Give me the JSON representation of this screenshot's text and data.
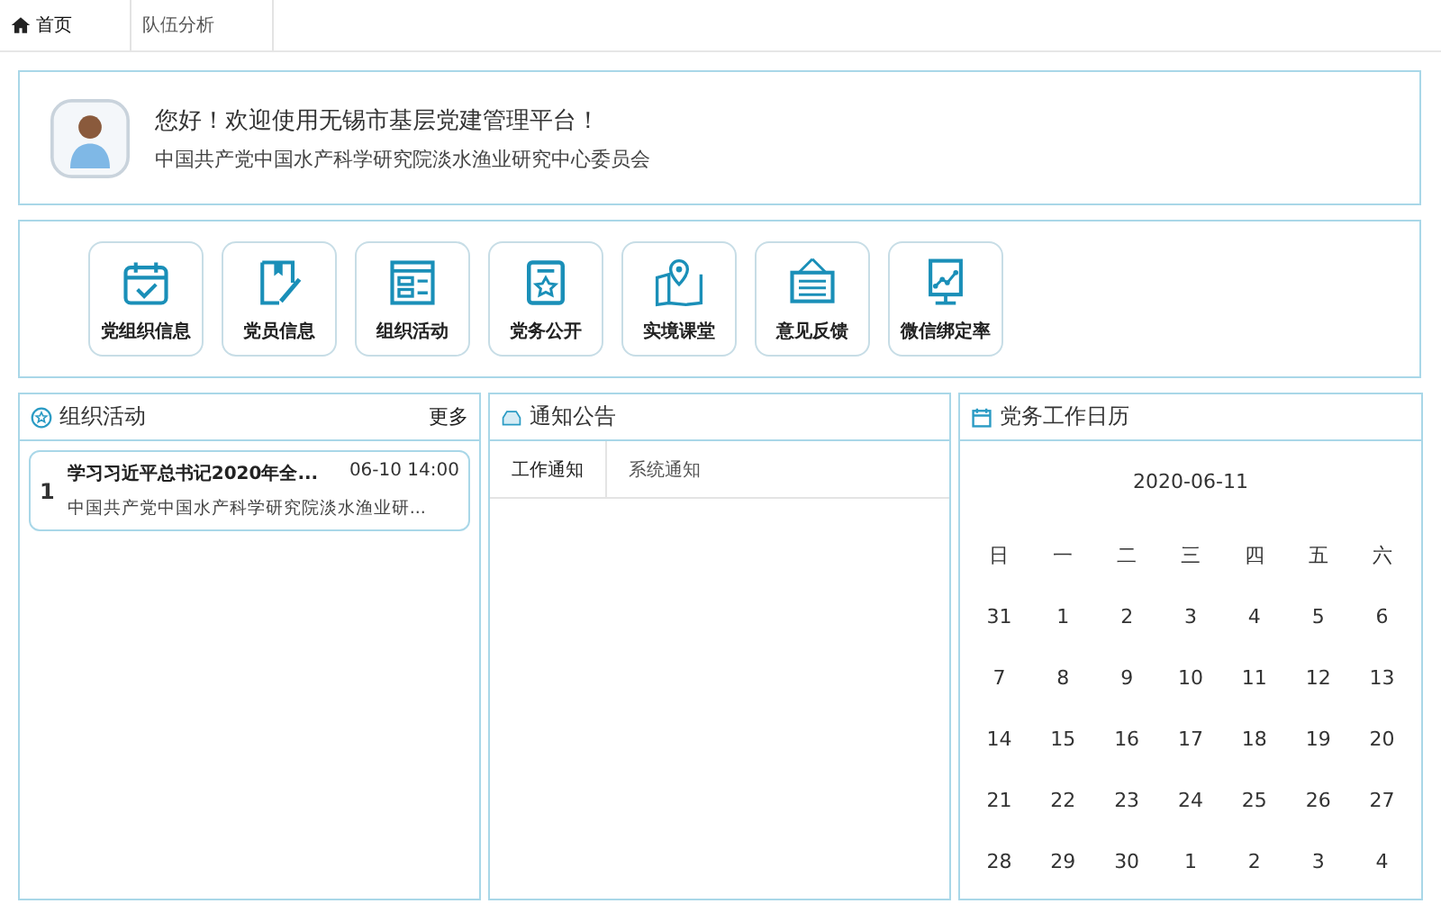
{
  "tabs": [
    {
      "label": "首页",
      "selected": true
    },
    {
      "label": "队伍分析",
      "selected": false
    }
  ],
  "welcome": {
    "greeting": "您好！欢迎使用无锡市基层党建管理平台！",
    "organization": "中国共产党中国水产科学研究院淡水渔业研究中心委员会"
  },
  "shortcuts": [
    "党组织信息",
    "党员信息",
    "组织活动",
    "党务公开",
    "实境课堂",
    "意见反馈",
    "微信绑定率"
  ],
  "activities": {
    "title": "组织活动",
    "more": "更多",
    "items": [
      {
        "number": "1",
        "title": "学习习近平总书记2020年全...",
        "time": "06-10 14:00",
        "organization": "中国共产党中国水产科学研究院淡水渔业研..."
      }
    ]
  },
  "notices": {
    "title": "通知公告",
    "tabs": [
      {
        "label": "工作通知",
        "selected": true
      },
      {
        "label": "系统通知",
        "selected": false
      }
    ]
  },
  "calendar": {
    "title": "党务工作日历",
    "date": "2020-06-11",
    "weekdays": [
      "日",
      "一",
      "二",
      "三",
      "四",
      "五",
      "六"
    ],
    "weeks": [
      [
        "31",
        "1",
        "2",
        "3",
        "4",
        "5",
        "6"
      ],
      [
        "7",
        "8",
        "9",
        "10",
        "11",
        "12",
        "13"
      ],
      [
        "14",
        "15",
        "16",
        "17",
        "18",
        "19",
        "20"
      ],
      [
        "21",
        "22",
        "23",
        "24",
        "25",
        "26",
        "27"
      ],
      [
        "28",
        "29",
        "30",
        "1",
        "2",
        "3",
        "4"
      ]
    ]
  }
}
